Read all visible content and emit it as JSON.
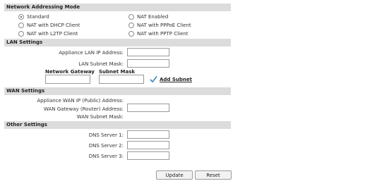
{
  "network_addressing": {
    "title": "Network Addressing Mode",
    "options": [
      {
        "label": "Standard",
        "checked": true
      },
      {
        "label": "NAT Enabled",
        "checked": false
      },
      {
        "label": "NAT with DHCP Client",
        "checked": false
      },
      {
        "label": "NAT with PPPoE Client",
        "checked": false
      },
      {
        "label": "NAT with L2TP Client",
        "checked": false
      },
      {
        "label": "NAT with PPTP Client",
        "checked": false
      }
    ]
  },
  "lan": {
    "title": "LAN Settings",
    "ip_label": "Appliance LAN IP Address:",
    "ip_value": "",
    "mask_label": "LAN Subnet Mask:",
    "mask_value": "",
    "gateway_header": "Network Gateway",
    "subnet_mask_header": "Subnet Mask",
    "gateway_value": "",
    "subnet_mask_value": "",
    "add_subnet": "Add Subnet"
  },
  "wan": {
    "title": "WAN Settings",
    "ip_label": "Appliance WAN IP (Public) Address:",
    "gateway_label": "WAN Gateway (Router) Address:",
    "gateway_value": "",
    "mask_label": "WAN Subnet Mask:"
  },
  "other": {
    "title": "Other Settings",
    "dns1_label": "DNS Server 1:",
    "dns1_value": "",
    "dns2_label": "DNS Server 2:",
    "dns2_value": "",
    "dns3_label": "DNS Server 3:",
    "dns3_value": ""
  },
  "buttons": {
    "update": "Update",
    "reset": "Reset"
  },
  "colors": {
    "section_bg": "#dcdcdc",
    "check_icon": "#4a90c8"
  }
}
